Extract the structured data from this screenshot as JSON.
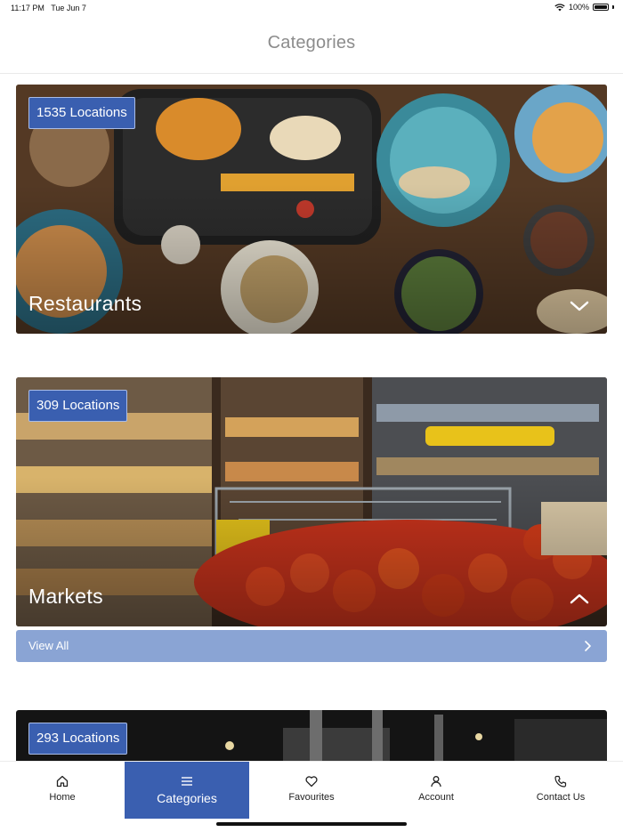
{
  "status_bar": {
    "time": "11:17 PM",
    "date": "Tue Jun 7",
    "battery": "100%",
    "icons": [
      "wifi-icon",
      "battery-icon"
    ]
  },
  "header": {
    "title": "Categories"
  },
  "categories": [
    {
      "label": "Restaurants",
      "locations": "1535 Locations",
      "expanded": false,
      "chevron": "chevron-down-icon"
    },
    {
      "label": "Markets",
      "locations": "309 Locations",
      "expanded": true,
      "chevron": "chevron-up-icon"
    },
    {
      "label": "",
      "locations": "293 Locations",
      "expanded": false
    }
  ],
  "view_all": {
    "label": "View All",
    "icon": "chevron-right-icon"
  },
  "tab_bar": {
    "active": "Categories",
    "tabs": [
      {
        "label": "Home",
        "icon": "home-icon"
      },
      {
        "label": "Categories",
        "icon": "menu-icon"
      },
      {
        "label": "Favourites",
        "icon": "heart-icon"
      },
      {
        "label": "Account",
        "icon": "user-icon"
      },
      {
        "label": "Contact Us",
        "icon": "phone-icon"
      }
    ]
  },
  "colors": {
    "accent": "#3a5fb0",
    "view_all_bg": "#8aa4d4",
    "title": "#8c8c8c"
  }
}
